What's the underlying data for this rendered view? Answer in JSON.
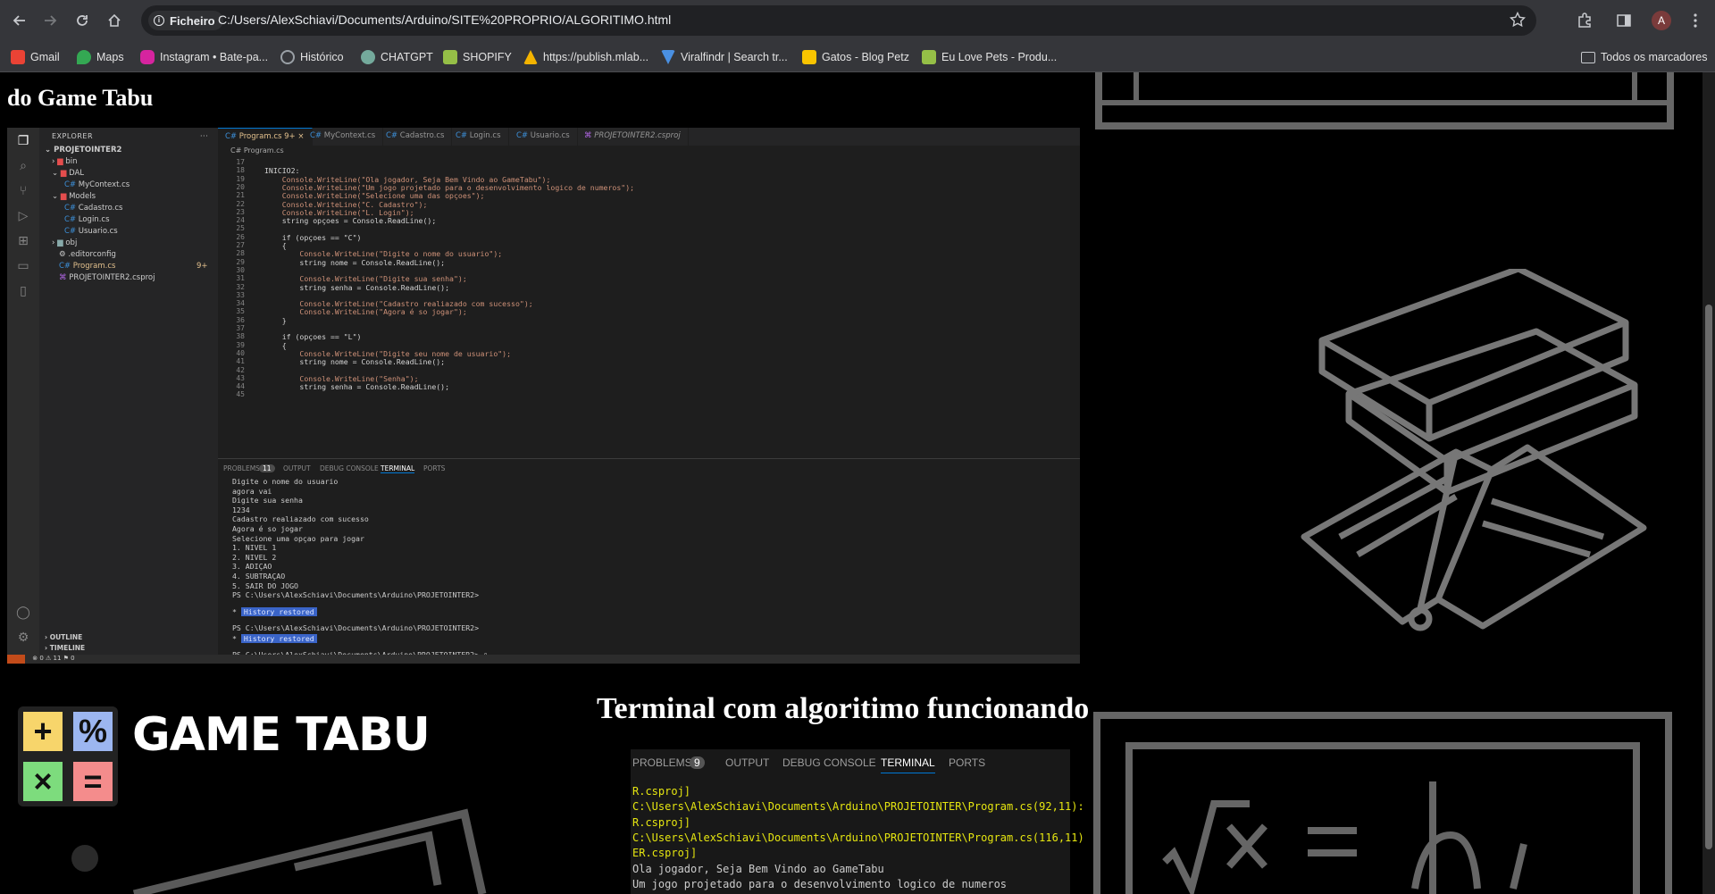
{
  "browser": {
    "site_info": "Ficheiro",
    "url": "C:/Users/AlexSchiavi/Documents/Arduino/SITE%20PROPRIO/ALGORITIMO.html",
    "avatar_letter": "A",
    "bookmarks": [
      {
        "label": "Gmail",
        "icon": "gmail-icon",
        "color": "#ea4335"
      },
      {
        "label": "Maps",
        "icon": "maps-icon",
        "color": "#34a853"
      },
      {
        "label": "Instagram • Bate-pa...",
        "icon": "instagram-icon",
        "color": "#d6249f"
      },
      {
        "label": "Histórico",
        "icon": "history-icon",
        "color": "#9aa0a6"
      },
      {
        "label": "CHATGPT",
        "icon": "chatgpt-icon",
        "color": "#74aa9c"
      },
      {
        "label": "SHOPIFY",
        "icon": "shopify-icon",
        "color": "#95bf47"
      },
      {
        "label": "https://publish.mlab...",
        "icon": "mlab-icon",
        "color": "#f4b400"
      },
      {
        "label": "Viralfindr | Search tr...",
        "icon": "viralfindr-icon",
        "color": "#4a90e2"
      },
      {
        "label": "Gatos - Blog Petz",
        "icon": "petz-icon",
        "color": "#f9c400"
      },
      {
        "label": "Eu Love Pets - Produ...",
        "icon": "shopify-icon",
        "color": "#95bf47"
      }
    ],
    "all_bookmarks": "Todos os marcadores"
  },
  "page": {
    "title_1": "do Game Tabu",
    "title_2": "Terminal com algoritimo funcionando",
    "logo_text": "GAME TABU",
    "logo_tiles": [
      "+",
      "%",
      "×",
      "="
    ]
  },
  "vscode": {
    "explorer_label": "EXPLORER",
    "project": "PROJETOINTER2",
    "tree": [
      "bin",
      "DAL",
      "MyContext.cs",
      "Models",
      "Cadastro.cs",
      "Login.cs",
      "Usuario.cs",
      "obj",
      ".editorconfig",
      "Program.cs",
      "PROJETOINTER2.csproj"
    ],
    "program_badge": "9+",
    "outline": "OUTLINE",
    "timeline": "TIMELINE",
    "tabs": [
      "Program.cs 9+",
      "MyContext.cs",
      "Cadastro.cs",
      "Login.cs",
      "Usuario.cs",
      "PROJETOINTER2.csproj"
    ],
    "breadcrumb": "C# Program.cs",
    "line_numbers": [
      "17",
      "18",
      "19",
      "20",
      "21",
      "22",
      "23",
      "24",
      "25",
      "26",
      "27",
      "28",
      "29",
      "30",
      "31",
      "32",
      "33",
      "34",
      "35",
      "36",
      "37",
      "38",
      "39",
      "40",
      "41",
      "42",
      "43",
      "44",
      "45"
    ],
    "code": [
      "",
      "INICIO2:",
      "    Console.WriteLine(\"Ola jogador, Seja Bem Vindo ao GameTabu\");",
      "    Console.WriteLine(\"Um jogo projetado para o desenvolvimento logico de numeros\");",
      "    Console.WriteLine(\"Selecione uma das opçoes\");",
      "    Console.WriteLine(\"C. Cadastro\");",
      "    Console.WriteLine(\"L. Login\");",
      "    string opçoes = Console.ReadLine();",
      "",
      "    if (opçoes == \"C\")",
      "    {",
      "        Console.WriteLine(\"Digite o nome do usuario\");",
      "        string nome = Console.ReadLine();",
      "",
      "        Console.WriteLine(\"Digite sua senha\");",
      "        string senha = Console.ReadLine();",
      "",
      "        Console.WriteLine(\"Cadastro realiazado com sucesso\");",
      "        Console.WriteLine(\"Agora é so jogar\");",
      "    }",
      "",
      "    if (opçoes == \"L\")",
      "    {",
      "        Console.WriteLine(\"Digite seu nome de usuario\");",
      "        string nome = Console.ReadLine();",
      "",
      "        Console.WriteLine(\"Senha\");",
      "        string senha = Console.ReadLine();",
      ""
    ],
    "panel_tabs": [
      "PROBLEMS",
      "11",
      "OUTPUT",
      "DEBUG CONSOLE",
      "TERMINAL",
      "PORTS"
    ],
    "terminal": [
      "Digite o nome do usuario",
      "agora vai",
      "Digite sua senha",
      "1234",
      "Cadastro realiazado com sucesso",
      "Agora é so jogar",
      "Selecione uma opçao para jogar",
      "1. NIVEL 1",
      "2. NIVEL 2",
      "3. ADIÇAO",
      "4. SUBTRAÇAO",
      "5. SAIR DO JOGO",
      "PS C:\\Users\\AlexSchiavi\\Documents\\Arduino\\PROJETOINTER2>"
    ],
    "history_restored": "History restored",
    "prompt": "PS C:\\Users\\AlexSchiavi\\Documents\\Arduino\\PROJETOINTER2>",
    "status": "⊗ 0 ⚠ 11   ⚑ 0"
  },
  "terminal2": {
    "tabs": [
      "PROBLEMS",
      "9",
      "OUTPUT",
      "DEBUG CONSOLE",
      "TERMINAL",
      "PORTS"
    ],
    "lines": [
      {
        "text": "R.csproj]",
        "color": "#e5e510"
      },
      {
        "text": "C:\\Users\\AlexSchiavi\\Documents\\Arduino\\PROJETOINTER\\Program.cs(92,11):",
        "color": "#e5e510"
      },
      {
        "text": "R.csproj]",
        "color": "#e5e510"
      },
      {
        "text": "C:\\Users\\AlexSchiavi\\Documents\\Arduino\\PROJETOINTER\\Program.cs(116,11)",
        "color": "#e5e510"
      },
      {
        "text": "ER.csproj]",
        "color": "#e5e510"
      },
      {
        "text": "Ola jogador, Seja Bem Vindo ao GameTabu",
        "color": "#cccccc"
      },
      {
        "text": "Um jogo projetado para o desenvolvimento logico de numeros",
        "color": "#cccccc"
      }
    ]
  }
}
